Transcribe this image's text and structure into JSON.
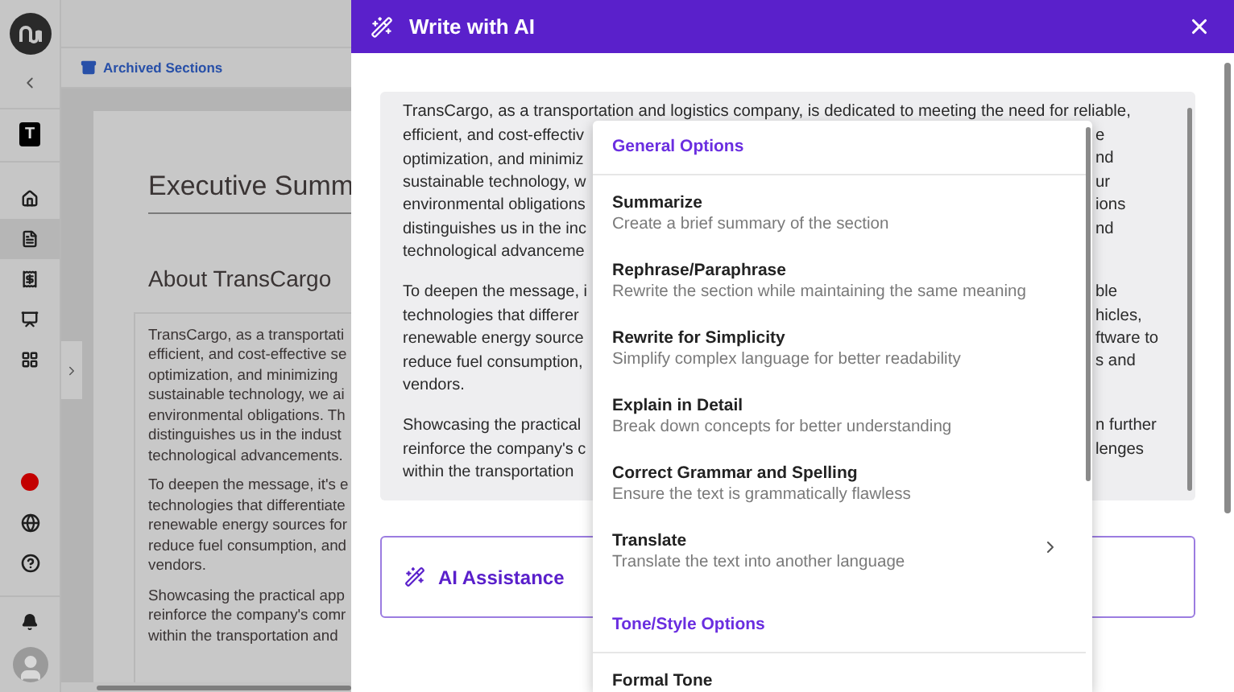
{
  "sidebar": {
    "workspace_badge": "T",
    "nav_items": [
      {
        "kind": "home",
        "selected": false
      },
      {
        "kind": "document",
        "selected": true
      },
      {
        "kind": "invoice",
        "selected": false
      },
      {
        "kind": "presentation",
        "selected": false
      },
      {
        "kind": "layout",
        "selected": false
      }
    ]
  },
  "document": {
    "toolbar_link": "Archived Sections",
    "title": "Executive Summ",
    "heading": "About TransCargo",
    "paragraphs": [
      [
        "TransCargo, as a transportati",
        "efficient, and cost-effective se",
        "optimization, and minimizing",
        "sustainable technology, we ai",
        "environmental obligations. Th",
        "distinguishes us in the indust",
        "technological advancements."
      ],
      [
        "To deepen the message, it's e",
        "technologies that differentiate",
        "renewable energy sources for",
        "reduce fuel consumption, and",
        "vendors."
      ],
      [
        "Showcasing the practical app",
        "reinforce the company's comr",
        "within the transportation and"
      ]
    ]
  },
  "drawer": {
    "title": "Write with AI",
    "content_first_line": "TransCargo, as a transportation and logistics company, is dedicated to meeting the need for reliable,",
    "content_paragraphs": [
      [
        {
          "left": "efficient, and cost-effectiv",
          "right": "e"
        },
        {
          "left": "optimization, and minimiz",
          "right": "nd"
        },
        {
          "left": "sustainable technology, w",
          "right": "ur"
        },
        {
          "left": "environmental obligations",
          "right": "ions"
        },
        {
          "left": "distinguishes us in the inc",
          "right": "nd"
        },
        {
          "left": "technological advanceme"
        }
      ],
      [
        {
          "left": "To deepen the message, i",
          "right": "ble"
        },
        {
          "left": "technologies that differer",
          "right": "hicles,"
        },
        {
          "left": "renewable energy source",
          "right": "ftware to"
        },
        {
          "left": "reduce fuel consumption,",
          "right": "s and"
        },
        {
          "left": "vendors."
        }
      ],
      [
        {
          "left": "Showcasing the practical",
          "right": "n further"
        },
        {
          "left": "reinforce the company's c",
          "right": "lenges"
        },
        {
          "left": "within the transportation"
        }
      ]
    ],
    "ai_assistance": {
      "label": "AI Assistance"
    },
    "menu": {
      "sections": [
        {
          "title": "General Options",
          "items": [
            {
              "label": "Summarize",
              "description": "Create a brief summary of the section",
              "has_submenu": false
            },
            {
              "label": "Rephrase/Paraphrase",
              "description": "Rewrite the section while maintaining the same meaning",
              "has_submenu": false
            },
            {
              "label": "Rewrite for Simplicity",
              "description": "Simplify complex language for better readability",
              "has_submenu": false
            },
            {
              "label": "Explain in Detail",
              "description": "Break down concepts for better understanding",
              "has_submenu": false
            },
            {
              "label": "Correct Grammar and Spelling",
              "description": "Ensure the text is grammatically flawless",
              "has_submenu": false
            },
            {
              "label": "Translate",
              "description": "Translate the text into another language",
              "has_submenu": true
            }
          ]
        },
        {
          "title": "Tone/Style Options",
          "items": [
            {
              "label": "Formal Tone",
              "has_submenu": false
            }
          ]
        }
      ]
    }
  }
}
